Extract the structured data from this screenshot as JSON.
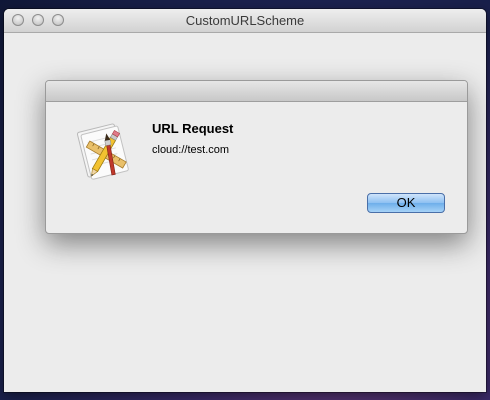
{
  "window": {
    "title": "CustomURLScheme"
  },
  "alert": {
    "icon": "script-editor-app-icon",
    "title": "URL Request",
    "message": "cloud://test.com",
    "ok_label": "OK"
  },
  "colors": {
    "default_button": "#8dc0f2",
    "window_background": "#ececec"
  }
}
